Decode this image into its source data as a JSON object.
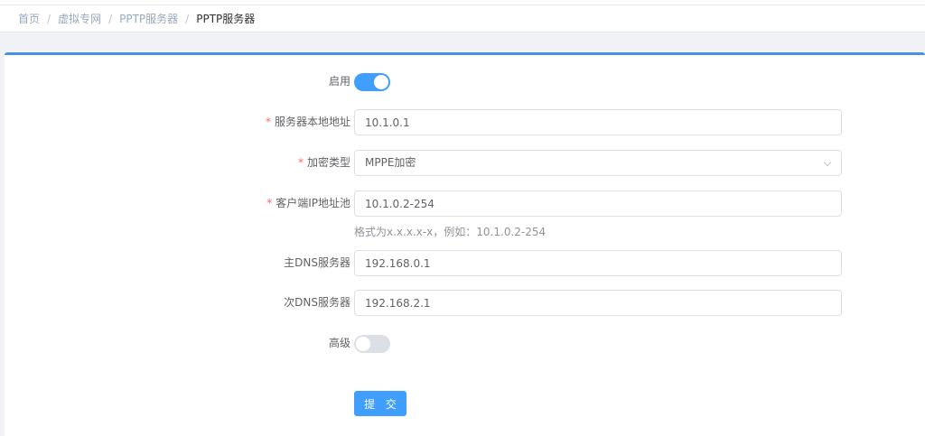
{
  "breadcrumb": {
    "items": [
      "首页",
      "虚拟专网",
      "PPTP服务器",
      "PPTP服务器"
    ],
    "separator": "/"
  },
  "form": {
    "enable": {
      "label": "启用",
      "on": true
    },
    "server_address": {
      "label": "服务器本地地址",
      "required": "*",
      "value": "10.1.0.1"
    },
    "encryption": {
      "label": "加密类型",
      "required": "*",
      "value": "MPPE加密"
    },
    "client_pool": {
      "label": "客户端IP地址池",
      "required": "*",
      "value": "10.1.0.2-254",
      "hint": "格式为x.x.x.x-x，例如：10.1.0.2-254"
    },
    "primary_dns": {
      "label": "主DNS服务器",
      "value": "192.168.0.1"
    },
    "secondary_dns": {
      "label": "次DNS服务器",
      "value": "192.168.2.1"
    },
    "advanced": {
      "label": "高级",
      "on": false
    },
    "submit_label": "提 交"
  },
  "colors": {
    "accent": "#409eff",
    "required": "#f56c6c",
    "card_border": "#4a90e2"
  }
}
